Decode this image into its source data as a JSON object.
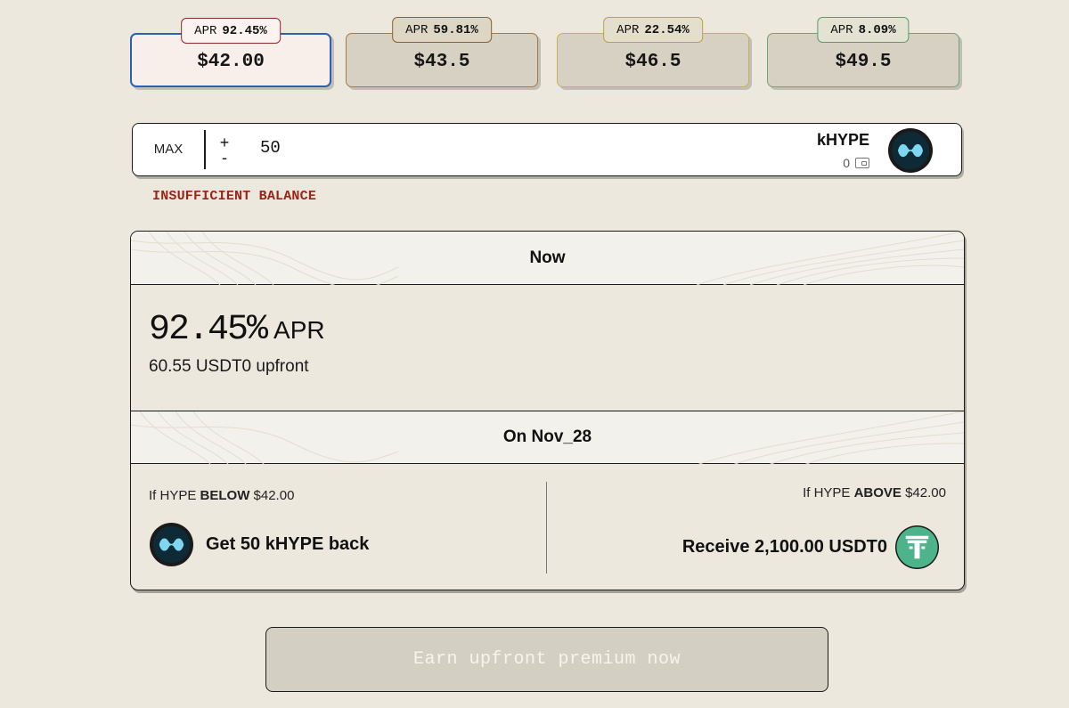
{
  "strikes": [
    {
      "apr_label": "APR",
      "apr_value": "92.45%",
      "price": "$42.00",
      "selected": true
    },
    {
      "apr_label": "APR",
      "apr_value": "59.81%",
      "price": "$43.5",
      "selected": false
    },
    {
      "apr_label": "APR",
      "apr_value": "22.54%",
      "price": "$46.5",
      "selected": false
    },
    {
      "apr_label": "APR",
      "apr_value": "8.09%",
      "price": "$49.5",
      "selected": false
    }
  ],
  "amount": {
    "max_label": "MAX",
    "plus_label": "+",
    "minus_label": "-",
    "value": "50",
    "token": "kHYPE",
    "balance": "0",
    "error": "INSUFFICIENT BALANCE"
  },
  "summary": {
    "now_header": "Now",
    "apr_value": "92.45%",
    "apr_unit": "APR",
    "upfront": "60.55 USDT0 upfront",
    "date_header": "On Nov_28",
    "below": {
      "prefix": "If HYPE",
      "keyword": "BELOW",
      "price": "$42.00",
      "result": "Get 50 kHYPE back"
    },
    "above": {
      "prefix": "If HYPE",
      "keyword": "ABOVE",
      "price": "$42.00",
      "result": "Receive 2,100.00 USDT0"
    }
  },
  "cta": {
    "label": "Earn upfront premium now"
  },
  "colors": {
    "background": "#ede8dd",
    "selected_border": "#2f5fb0",
    "error": "#9a2418",
    "usdt_green": "#4cb38a",
    "cta_disabled": "#d3cfc2"
  },
  "icons": {
    "khype": "khype-logo-icon",
    "usdt0": "usdt0-logo-icon",
    "wallet": "wallet-icon"
  }
}
